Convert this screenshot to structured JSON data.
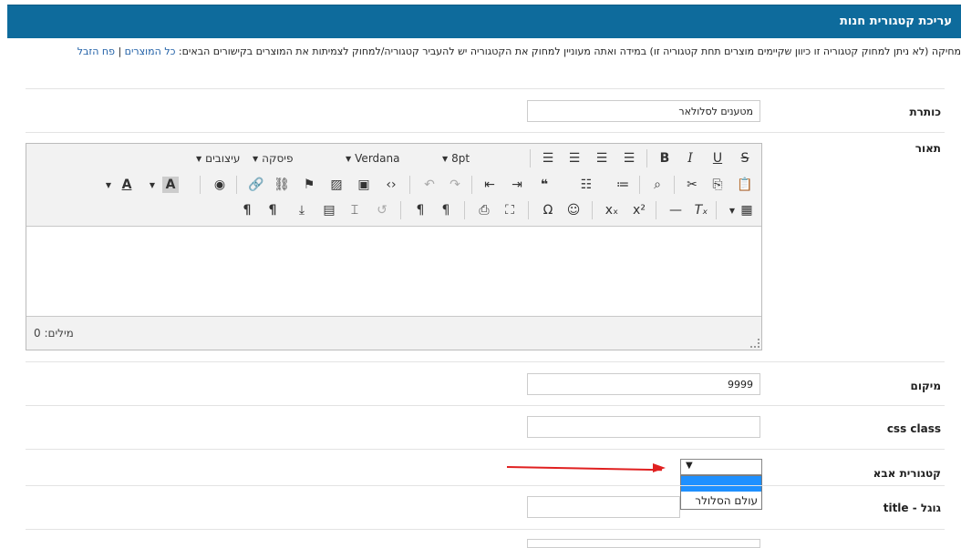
{
  "header": {
    "title": "עריכת קטגורית חנות"
  },
  "notice": {
    "text": "מחיקה (לא ניתן למחוק קטגוריה זו כיוון שקיימים מוצרים תחת קטגוריה זו) במידה ואתה מעוניין למחוק את הקטגוריה יש להעביר קטגוריה/למחוק לצמיתות את המוצרים בקישורים הבאים:",
    "link_all_products": "כל המוצרים",
    "separator": "|",
    "link_trash": "פח הזבל"
  },
  "form": {
    "title_label": "כותרת",
    "title_value": "מטענים לסלולאר",
    "description_label": "תאור",
    "position_label": "מיקום",
    "position_value": "9999",
    "css_label": "css class",
    "css_value": "",
    "parent_label": "קטגורית אבא",
    "parent_selected": "",
    "parent_options": [
      "",
      "עולם הסלולר"
    ],
    "google_title_label": "גוגל - title",
    "google_title_value": ""
  },
  "editor": {
    "styles_label": "עיצובים",
    "paragraph_label": "פיסקה",
    "font_label": "Verdana",
    "size_label": "8pt",
    "word_count": "מילים: 0",
    "icons": [
      "strikethrough-icon",
      "underline-icon",
      "italic-icon",
      "bold-icon",
      "align-justify-icon",
      "align-right-icon",
      "align-center-icon",
      "align-left-icon",
      "paste-icon",
      "copy-icon",
      "cut-icon",
      "find-icon",
      "numbered-list-icon",
      "bullet-list-icon",
      "blockquote-icon",
      "indent-icon",
      "outdent-icon",
      "redo-icon",
      "undo-icon",
      "source-code-icon",
      "media-icon",
      "image-icon",
      "bookmark-icon",
      "unlink-icon",
      "link-icon",
      "preview-icon",
      "background-color-icon",
      "text-color-icon",
      "table-icon",
      "clear-format-icon",
      "horizontal-rule-icon",
      "superscript-icon",
      "subscript-icon",
      "emoticon-icon",
      "special-char-icon",
      "fullscreen-icon",
      "print-icon",
      "rtl-icon",
      "ltr-icon",
      "restore-icon",
      "pagebreak-icon",
      "template-icon",
      "insert-icon",
      "show-blocks-icon",
      "paragraph-mark-icon"
    ]
  }
}
